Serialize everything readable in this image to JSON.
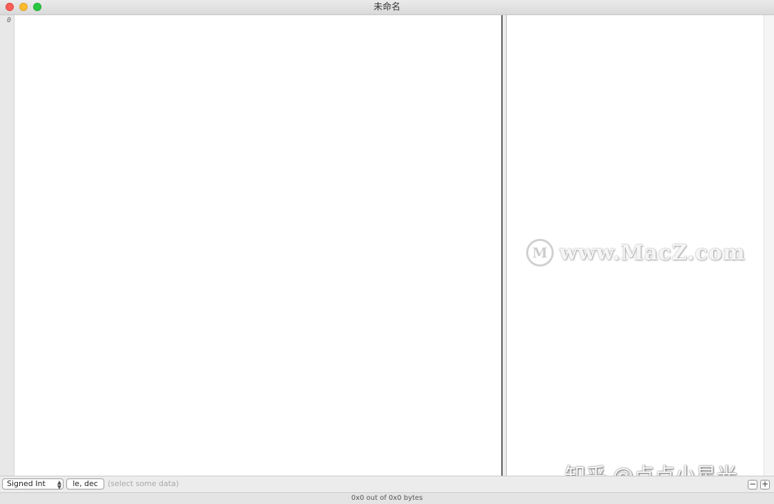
{
  "window": {
    "title": "未命名"
  },
  "gutter": {
    "first_offset": "0"
  },
  "toolbar": {
    "data_type": "Signed Int",
    "format_button": "le, dec",
    "hint": "(select some data)",
    "zoom_out": "−",
    "zoom_in": "+"
  },
  "status": {
    "text": "0x0 out of 0x0 bytes"
  },
  "watermark": {
    "logo_letter": "M",
    "site_text": "www.MacZ.com",
    "zh_text": "知乎 @点点小星光"
  },
  "colors": {
    "close": "#fc5f57",
    "minimize": "#fdbc2e",
    "zoom": "#28c840"
  }
}
